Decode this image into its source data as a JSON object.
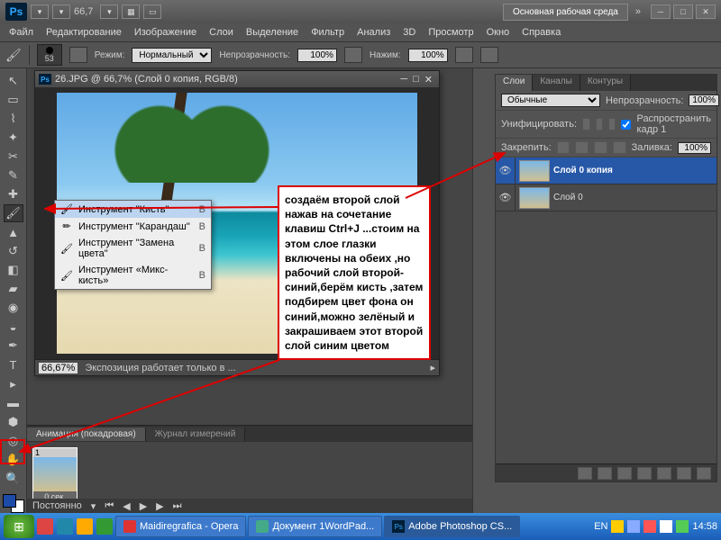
{
  "titlebar": {
    "logo": "Ps",
    "zoom_display": "66,7",
    "workspace_button": "Основная рабочая среда"
  },
  "menu": [
    "Файл",
    "Редактирование",
    "Изображение",
    "Слои",
    "Выделение",
    "Фильтр",
    "Анализ",
    "3D",
    "Просмотр",
    "Окно",
    "Справка"
  ],
  "options": {
    "brush_size": "53",
    "mode_label": "Режим:",
    "mode_value": "Нормальный",
    "opacity_label": "Непрозрачность:",
    "opacity_value": "100%",
    "flow_label": "Нажим:",
    "flow_value": "100%"
  },
  "document": {
    "title": "26.JPG @ 66,7% (Слой 0 копия, RGB/8)",
    "status_zoom": "66,67%",
    "status_text": "Экспозиция работает только в ..."
  },
  "brush_flyout": {
    "items": [
      {
        "icon": "🖌",
        "label": "Инструмент \"Кисть\"",
        "key": "B",
        "sel": true
      },
      {
        "icon": "✏",
        "label": "Инструмент \"Карандаш\"",
        "key": "B",
        "sel": false
      },
      {
        "icon": "🖌",
        "label": "Инструмент \"Замена цвета\"",
        "key": "B",
        "sel": false
      },
      {
        "icon": "🖌",
        "label": "Инструмент «Микс-кисть»",
        "key": "B",
        "sel": false
      }
    ]
  },
  "annotation": "создаём  второй слой нажав на сочетание клавиш Ctrl+J   ...стоим на этом слое глазки включены на обеих ,но рабочий слой второй-синий,берём кисть ,затем подбирем цвет фона он синий,можно зелёный и закрашиваем этот второй слой синим цветом",
  "animation": {
    "tabs": [
      "Анимация (покадровая)",
      "Журнал измерений"
    ],
    "frame_number": "1",
    "frame_duration": "0 сек.",
    "loop_label": "Постоянно"
  },
  "layers_panel": {
    "tabs": [
      "Слои",
      "Каналы",
      "Контуры"
    ],
    "blend_mode": "Обычные",
    "opacity_label": "Непрозрачность:",
    "opacity_value": "100%",
    "unify_label": "Унифицировать:",
    "propagate_label": "Распространить кадр 1",
    "lock_label": "Закрепить:",
    "fill_label": "Заливка:",
    "fill_value": "100%",
    "layers": [
      {
        "name": "Слой 0 копия",
        "selected": true
      },
      {
        "name": "Слой 0",
        "selected": false
      }
    ]
  },
  "taskbar": {
    "tasks": [
      {
        "icon": "O",
        "label": "Maidiregrafica - Opera",
        "color": "#d33"
      },
      {
        "icon": "W",
        "label": "Документ 1WordPad...",
        "color": "#4a8"
      },
      {
        "icon": "Ps",
        "label": "Adobe Photoshop CS...",
        "color": "#13a",
        "active": true
      }
    ],
    "lang": "EN",
    "time": "14:58"
  }
}
